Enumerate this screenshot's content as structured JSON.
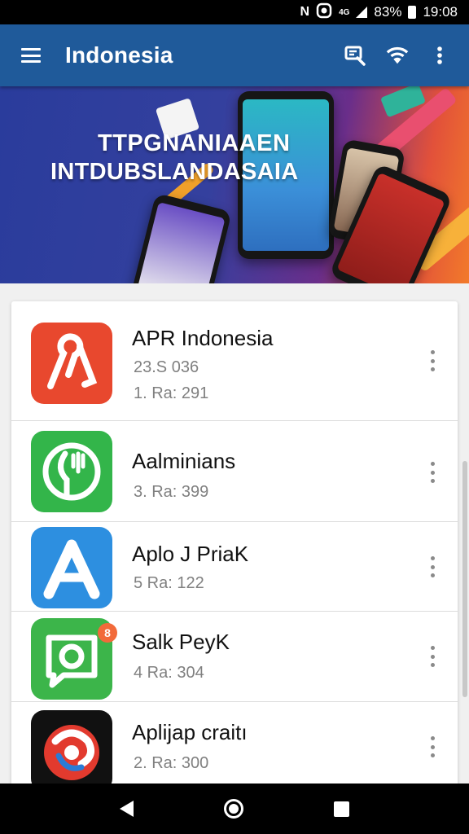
{
  "status_bar": {
    "icons": [
      "nfc-icon",
      "sync-icon",
      "signal-icon",
      "battery-icon"
    ],
    "network": "4G",
    "battery": "83%",
    "time": "19:08"
  },
  "app_bar": {
    "title": "Indonesia",
    "color": "#1f5a9a",
    "actions": [
      "search-icon",
      "wifi-icon",
      "more-vert-icon"
    ]
  },
  "banner": {
    "line1": "TTPGNANIAAEN",
    "line2": "INTDUBSLANDASAIA"
  },
  "apps": [
    {
      "name": "APR Indonesia",
      "meta1": "23.S 036",
      "meta2": "1. Ra: 291",
      "icon": "pin-logo-icon",
      "icon_color": "#e8482e"
    },
    {
      "name": "Aalminians",
      "meta2": "3. Ra: 399",
      "icon": "fork-leaf-logo-icon",
      "icon_color": "#33b54a"
    },
    {
      "name": "Aplo J PriaK",
      "meta2": "5  Ra: 122",
      "icon": "letter-a-logo-icon",
      "icon_color": "#2d8fe0"
    },
    {
      "name": "Salk PeyK",
      "meta2": "4  Ra: 304",
      "icon": "chat-camera-logo-icon",
      "icon_color": "#3cb54a",
      "badge": "8"
    },
    {
      "name": "Aplijap craitı",
      "meta2": "2. Ra: 300",
      "icon": "red-swirl-logo-icon",
      "icon_color": "#e23a2e"
    }
  ],
  "nav_bar": {
    "buttons": [
      "back-icon",
      "home-icon",
      "recents-icon"
    ]
  }
}
